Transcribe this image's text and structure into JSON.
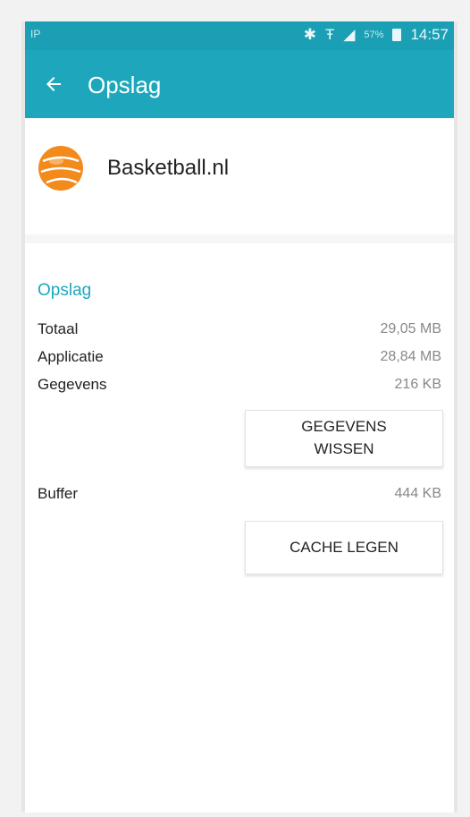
{
  "status_bar": {
    "left_text": "IP",
    "signal_text": "57%",
    "time": "14:57",
    "icons": [
      "bluetooth-icon",
      "wifi-icon",
      "signal-icon",
      "battery-icon"
    ]
  },
  "app_bar": {
    "title": "Opslag",
    "back_icon": "arrow-left-icon",
    "color": "#1ea7bc"
  },
  "app": {
    "name": "Basketball.nl",
    "icon": "basketball-icon",
    "icon_color": "#f28a1c"
  },
  "storage": {
    "section_title": "Opslag",
    "rows": [
      {
        "label": "Totaal",
        "value": "29,05 MB"
      },
      {
        "label": "Applicatie",
        "value": "28,84 MB"
      },
      {
        "label": "Gegevens",
        "value": "216 KB"
      }
    ],
    "clear_data_button": {
      "line1": "GEGEVENS",
      "line2": "WISSEN"
    },
    "buffer": {
      "label": "Buffer",
      "value": "444 KB"
    },
    "clear_cache_button": "CACHE LEGEN"
  }
}
